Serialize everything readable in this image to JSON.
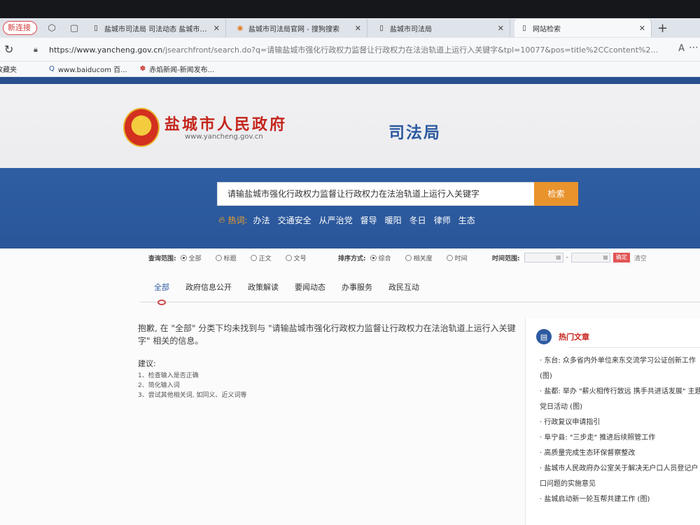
{
  "browser": {
    "new_pill": "新连接",
    "tabs": [
      {
        "title": "盐城市司法局 司法动态 盐城市司法局",
        "favicon": "doc-icon"
      },
      {
        "title": "盐城市司法局官网 - 搜狗搜索",
        "favicon": "sogou-icon"
      },
      {
        "title": "盐城市司法局",
        "favicon": "doc-icon"
      },
      {
        "title": "网站检索",
        "favicon": "doc-icon"
      }
    ],
    "url_domain": "https://www.yancheng.gov.cn",
    "url_rest": "/jsearchfront/search.do?q=请输盐城市强化行政权力监督让行政权力在法治轨道上运行入关键字&tpl=10077&pos=title%2CCcontent%2...",
    "bookmarks": [
      "收藏夹",
      "www.baiducom 百...",
      "赤焰新闻-新闻发布..."
    ]
  },
  "header": {
    "site_title": "盐城市人民政府",
    "site_domain": "www.yancheng.gov.cn",
    "dept_title": "司法局"
  },
  "search": {
    "query": "请输盐城市强化行政权力监督让行政权力在法治轨道上运行入关键字",
    "button": "检索",
    "hot_label": "热词:",
    "hot_words": [
      "办法",
      "交通安全",
      "从严治党",
      "督导",
      "暖阳",
      "冬日",
      "律师",
      "生态"
    ]
  },
  "filters": {
    "scope_label": "查询范围:",
    "scope_options": [
      "全部",
      "标题",
      "正文",
      "文号"
    ],
    "sort_label": "排序方式:",
    "sort_options": [
      "综合",
      "相关度",
      "时间"
    ],
    "time_label": "时间范围:",
    "confirm": "确定",
    "clear": "清空"
  },
  "categories": [
    "全部",
    "政府信息公开",
    "政策解读",
    "要闻动态",
    "办事服务",
    "政民互动"
  ],
  "results": {
    "not_found": "抱歉, 在 \"全部\" 分类下均未找到与 \"请输盐城市强化行政权力监督让行政权力在法治轨道上运行入关键字\" 相关的信息。",
    "suggest_title": "建议:",
    "suggestions": [
      "1、检查输入是否正确",
      "2、简化输入词",
      "3、尝试其他相关词, 如同义、近义词等"
    ]
  },
  "hot_articles": {
    "title": "热门文章",
    "items": [
      "东台: 众多省内外单位来东交流学习公证创新工作 (图)",
      "盐都: 举办 \"薪火相传行致远 携手共进话发展\" 主题党日活动 (图)",
      "行政复议申请指引",
      "阜宁县: \"三步走\" 推进后续照管工作",
      "高质量完成生态环保督察整改",
      "盐城市人民政府办公室关于解决无户口人员登记户口问题的实施意见",
      "盐城启动新一轮互帮共建工作 (图)"
    ]
  }
}
